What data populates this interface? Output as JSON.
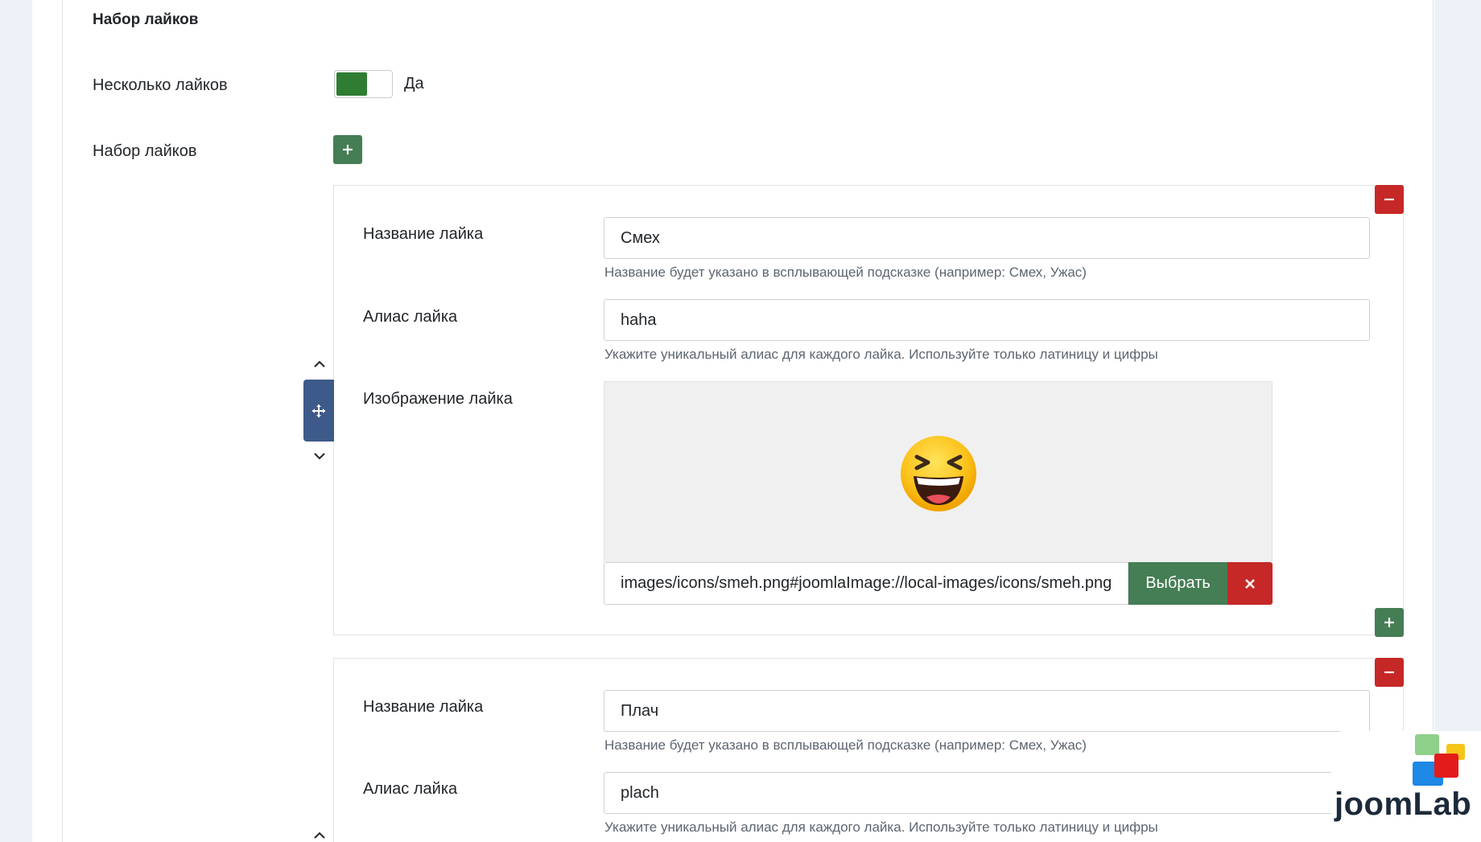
{
  "fieldset": {
    "legend": "Набор лайков"
  },
  "multiple": {
    "label": "Несколько лайков",
    "value_label": "Да",
    "checked": true
  },
  "set": {
    "label": "Набор лайков"
  },
  "items": [
    {
      "name_label": "Название лайка",
      "name_value": "Смех",
      "name_hint": "Название будет указано в всплывающей подсказке (например: Смех, Ужас)",
      "alias_label": "Алиас лайка",
      "alias_value": "haha",
      "alias_hint": "Укажите уникальный алиас для каждого лайка. Используйте только латиницу и цифры",
      "image_label": "Изображение лайка",
      "image_path": "images/icons/smeh.png#joomlaImage://local-images/icons/smeh.png",
      "select_label": "Выбрать",
      "image_icon": "laughing-emoji-icon"
    },
    {
      "name_label": "Название лайка",
      "name_value": "Плач",
      "name_hint": "Название будет указано в всплывающей подсказке (например: Смех, Ужас)",
      "alias_label": "Алиас лайка",
      "alias_value": "plach",
      "alias_hint": "Укажите уникальный алиас для каждого лайка. Используйте только латиницу и цифры"
    }
  ],
  "branding": {
    "logo_text": "joomLab"
  },
  "colors": {
    "green": "#457d54",
    "red": "#c52827",
    "handle": "#3d5a8a",
    "toggle_on": "#2e7d32"
  }
}
